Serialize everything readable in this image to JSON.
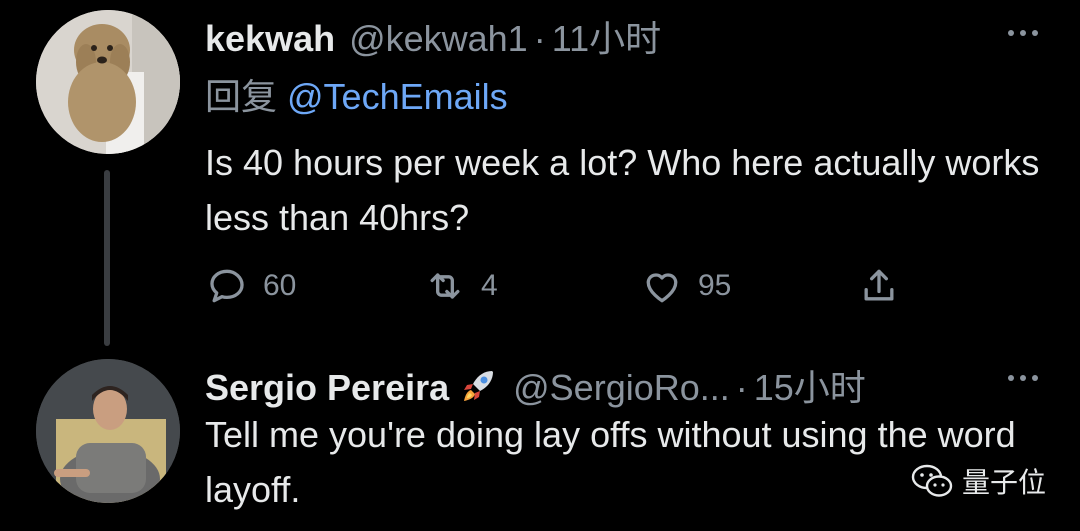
{
  "tweets": [
    {
      "name": "kekwah",
      "handle": "@kekwah1",
      "separator": "·",
      "time": "11小时",
      "reply_prefix": "回复",
      "reply_to": "@TechEmails",
      "text": "Is 40 hours per week a lot? Who here actually works less than 40hrs?",
      "replies": "60",
      "retweets": "4",
      "likes": "95"
    },
    {
      "name": "Sergio Pereira",
      "emoji": "rocket",
      "handle": "@SergioRo...",
      "separator": "·",
      "time": "15小时",
      "text": "Tell me you're doing lay offs without using the word layoff."
    }
  ],
  "icons": {
    "reply": "comment-bubble-icon",
    "retweet": "retweet-icon",
    "like": "heart-icon",
    "share": "share-icon",
    "more": "more-dots-icon"
  },
  "watermark": {
    "label": "量子位"
  },
  "colors": {
    "background": "#000000",
    "text": "#e7e9ea",
    "muted": "#8b949e",
    "link": "#6ea8f7"
  }
}
